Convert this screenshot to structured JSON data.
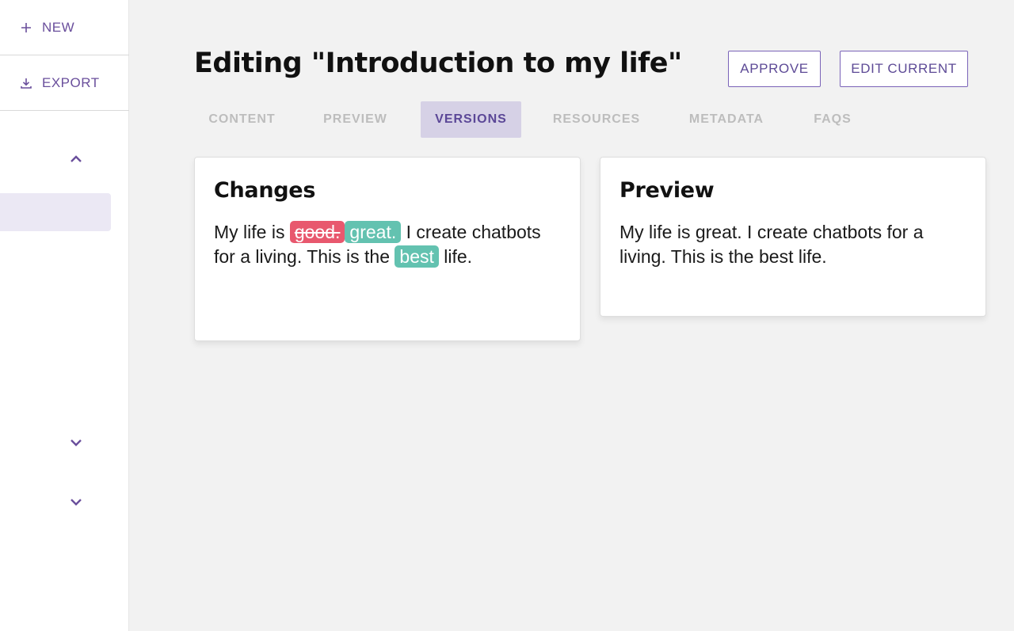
{
  "sidebar": {
    "new_label": "NEW",
    "export_label": "EXPORT",
    "icons": [
      "plus-icon",
      "download-icon",
      "chevron-up-icon",
      "chevron-down-icon",
      "chevron-down-icon"
    ]
  },
  "header": {
    "title": "Editing \"Introduction to my life\"",
    "approve_label": "APPROVE",
    "edit_current_label": "EDIT CURRENT"
  },
  "tabs": [
    {
      "label": "CONTENT",
      "active": false
    },
    {
      "label": "PREVIEW",
      "active": false
    },
    {
      "label": "VERSIONS",
      "active": true
    },
    {
      "label": "RESOURCES",
      "active": false
    },
    {
      "label": "METADATA",
      "active": false
    },
    {
      "label": "FAQS",
      "active": false
    }
  ],
  "changes": {
    "title": "Changes",
    "text_1": "My life is ",
    "deleted_1": "good.",
    "inserted_1": "great.",
    "text_2": " I create chatbots for a living. This is the ",
    "inserted_2": "best",
    "text_3": " life."
  },
  "preview": {
    "title": "Preview",
    "text": "My life is great. I create chatbots for a living. This is the best life."
  },
  "colors": {
    "accent": "#6a4f9c",
    "deleted_bg": "#e8586e",
    "inserted_bg": "#63c2b0",
    "active_tab_bg": "#d6d1e6"
  }
}
